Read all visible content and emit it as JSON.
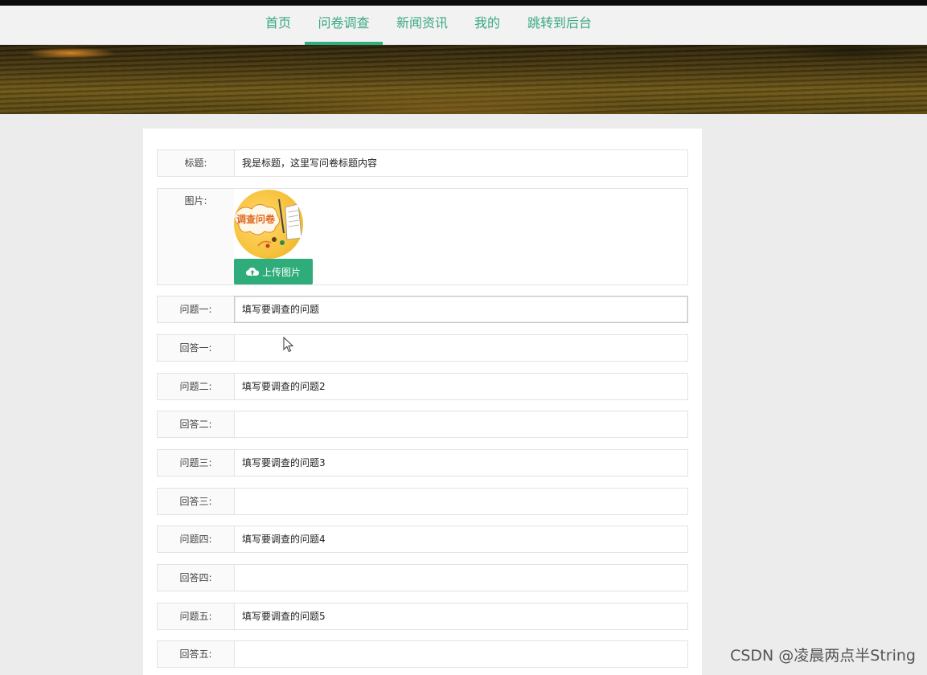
{
  "nav": {
    "items": [
      "首页",
      "问卷调查",
      "新闻资讯",
      "我的",
      "跳转到后台"
    ],
    "active_index": 1
  },
  "form": {
    "title_label": "标题:",
    "title_value": "我是标题，这里写问卷标题内容",
    "image_label": "图片:",
    "image_text": "调查问卷",
    "upload_label": "上传图片",
    "rows": [
      {
        "label": "问题一:",
        "value": "填写要调查的问题"
      },
      {
        "label": "回答一:",
        "value": ""
      },
      {
        "label": "问题二:",
        "value": "填写要调查的问题2"
      },
      {
        "label": "回答二:",
        "value": ""
      },
      {
        "label": "问题三:",
        "value": "填写要调查的问题3"
      },
      {
        "label": "回答三:",
        "value": ""
      },
      {
        "label": "问题四:",
        "value": "填写要调查的问题4"
      },
      {
        "label": "回答四:",
        "value": ""
      },
      {
        "label": "问题五:",
        "value": "填写要调查的问题5"
      },
      {
        "label": "回答五:",
        "value": ""
      }
    ]
  },
  "watermark": "CSDN @凌晨两点半String",
  "colors": {
    "accent": "#2eac7a",
    "nav_text": "#3aa882"
  },
  "icons": [
    "cloud-upload-icon",
    "mouse-cursor-icon"
  ]
}
